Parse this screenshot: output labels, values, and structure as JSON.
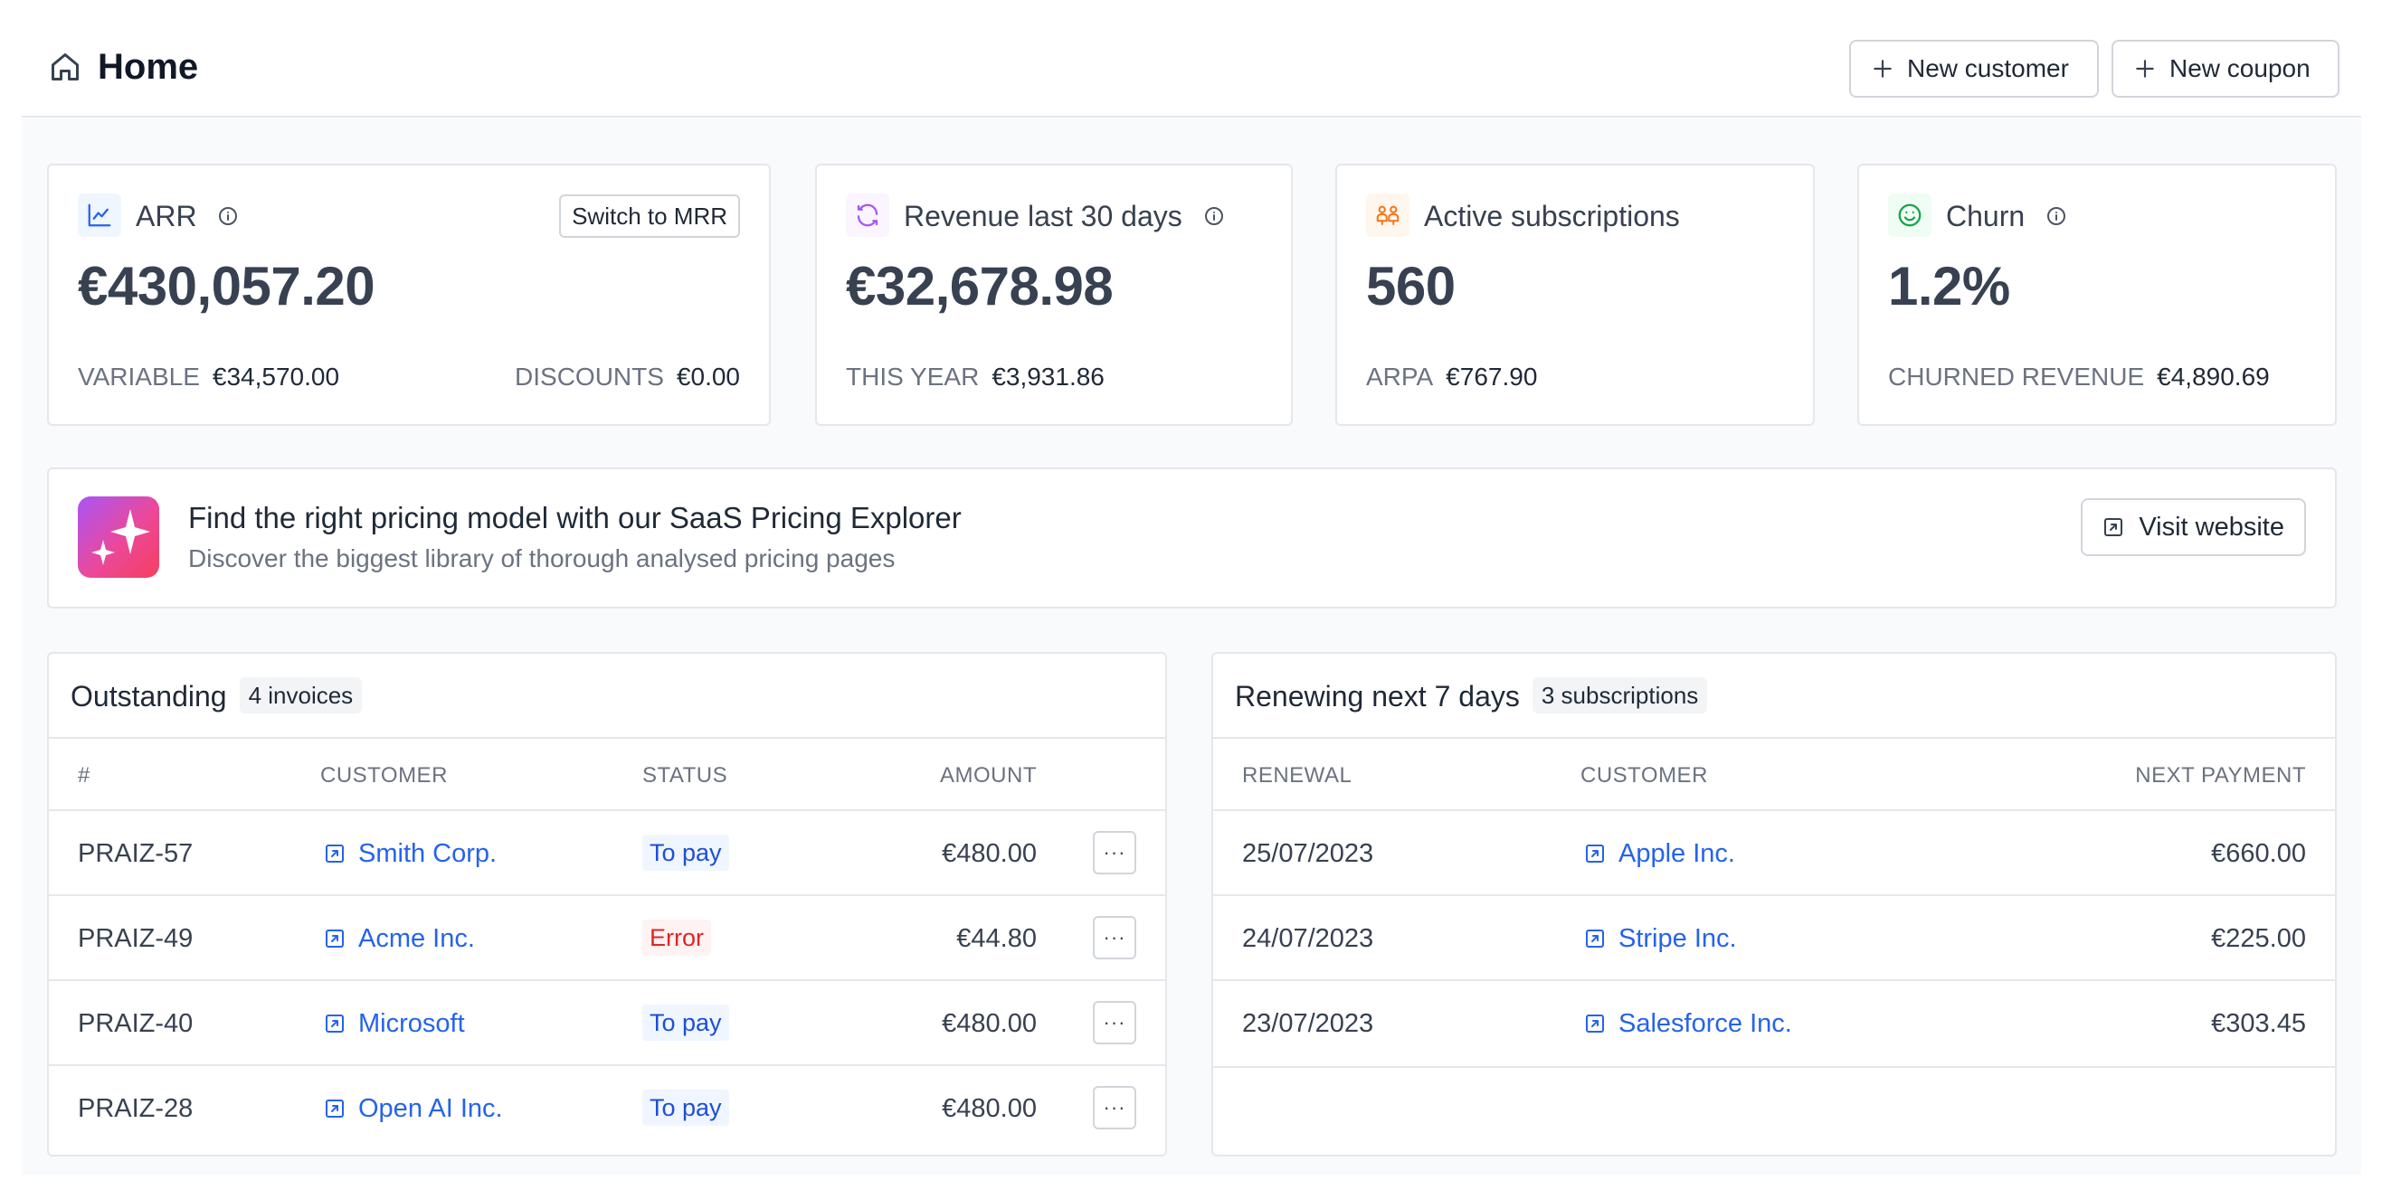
{
  "header": {
    "title": "Home",
    "new_customer": "New customer",
    "new_coupon": "New coupon"
  },
  "metrics": {
    "arr": {
      "label": "ARR",
      "value": "€430,057.20",
      "switch_label": "Switch to MRR",
      "variable_label": "VARIABLE",
      "variable_value": "€34,570.00",
      "discounts_label": "DISCOUNTS",
      "discounts_value": "€0.00",
      "icon": "chart-line-icon",
      "color": "#2563eb"
    },
    "revenue": {
      "label": "Revenue last 30 days",
      "value": "€32,678.98",
      "year_label": "THIS YEAR",
      "year_value": "€3,931.86",
      "icon": "refresh-icon",
      "color": "#a855f7"
    },
    "subscriptions": {
      "label": "Active subscriptions",
      "value": "560",
      "arpa_label": "ARPA",
      "arpa_value": "€767.90",
      "icon": "users-icon",
      "color": "#f97316"
    },
    "churn": {
      "label": "Churn",
      "value": "1.2%",
      "churned_label": "CHURNED REVENUE",
      "churned_value": "€4,890.69",
      "icon": "smile-icon",
      "color": "#16a34a"
    }
  },
  "banner": {
    "title": "Find the right pricing model with our SaaS Pricing Explorer",
    "subtitle": "Discover the biggest library of thorough analysed pricing pages",
    "button": "Visit website"
  },
  "outstanding": {
    "title": "Outstanding",
    "badge": "4 invoices",
    "columns": [
      "#",
      "CUSTOMER",
      "STATUS",
      "AMOUNT"
    ],
    "rows": [
      {
        "id": "PRAIZ-57",
        "customer": "Smith Corp.",
        "status": "To pay",
        "amount": "€480.00"
      },
      {
        "id": "PRAIZ-49",
        "customer": "Acme Inc.",
        "status": "Error",
        "amount": "€44.80"
      },
      {
        "id": "PRAIZ-40",
        "customer": "Microsoft",
        "status": "To pay",
        "amount": "€480.00"
      },
      {
        "id": "PRAIZ-28",
        "customer": "Open AI Inc.",
        "status": "To pay",
        "amount": "€480.00"
      }
    ],
    "more_label": "···"
  },
  "renewing": {
    "title": "Renewing next 7 days",
    "badge": "3 subscriptions",
    "columns": [
      "RENEWAL",
      "CUSTOMER",
      "NEXT PAYMENT"
    ],
    "rows": [
      {
        "date": "25/07/2023",
        "customer": "Apple Inc.",
        "amount": "€660.00"
      },
      {
        "date": "24/07/2023",
        "customer": "Stripe Inc.",
        "amount": "€225.00"
      },
      {
        "date": "23/07/2023",
        "customer": "Salesforce Inc.",
        "amount": "€303.45"
      }
    ]
  }
}
